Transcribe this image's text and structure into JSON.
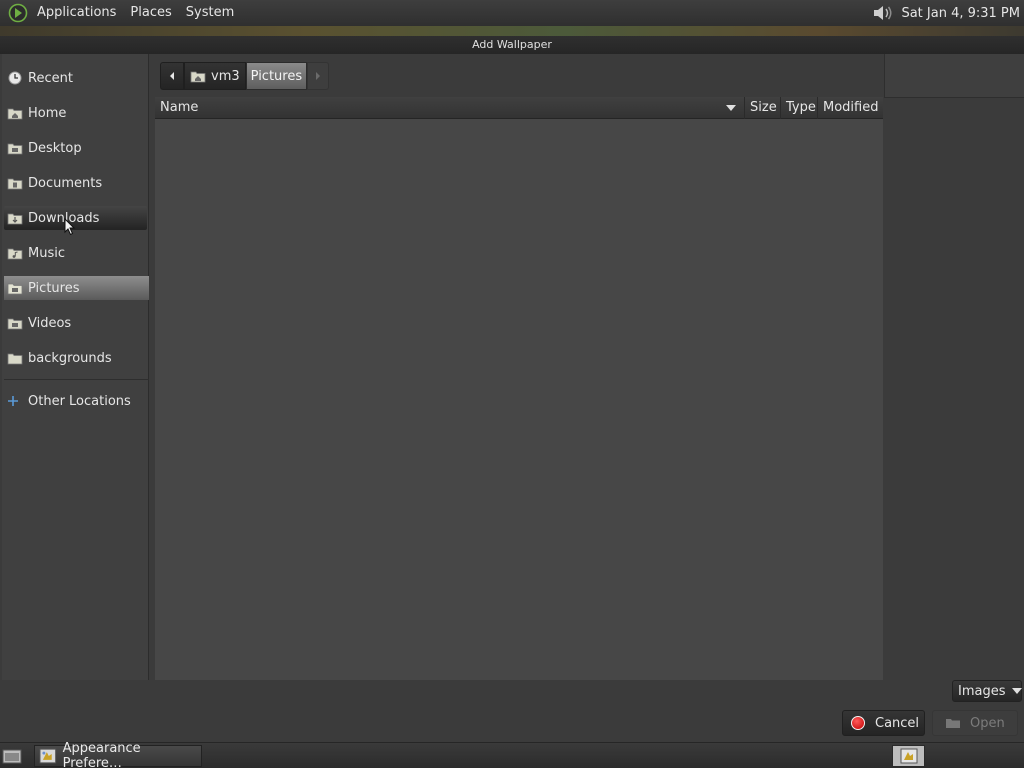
{
  "top_panel": {
    "menus": [
      "Applications",
      "Places",
      "System"
    ],
    "clock": "Sat Jan  4,  9:31 PM"
  },
  "dialog": {
    "title": "Add Wallpaper"
  },
  "sidebar": {
    "items": [
      {
        "label": "Recent",
        "icon": "recent-icon"
      },
      {
        "label": "Home",
        "icon": "home-folder-icon"
      },
      {
        "label": "Desktop",
        "icon": "desktop-folder-icon"
      },
      {
        "label": "Documents",
        "icon": "documents-folder-icon"
      },
      {
        "label": "Downloads",
        "icon": "downloads-folder-icon"
      },
      {
        "label": "Music",
        "icon": "music-folder-icon"
      },
      {
        "label": "Pictures",
        "icon": "pictures-folder-icon"
      },
      {
        "label": "Videos",
        "icon": "videos-folder-icon"
      },
      {
        "label": "backgrounds",
        "icon": "folder-icon"
      }
    ],
    "other_locations": "Other Locations",
    "selected": "Pictures",
    "hovered": "Downloads"
  },
  "pathbar": {
    "crumbs": [
      "vm3",
      "Pictures"
    ]
  },
  "file_list": {
    "columns": [
      "Name",
      "Size",
      "Type",
      "Modified"
    ],
    "rows": []
  },
  "filter": {
    "selected": "Images"
  },
  "buttons": {
    "cancel": "Cancel",
    "open": "Open"
  },
  "taskbar": {
    "tasks": [
      "Appearance Prefere…"
    ]
  },
  "colors": {
    "selected_item": "#7a7a7a",
    "cancel_icon": "#e01010"
  }
}
